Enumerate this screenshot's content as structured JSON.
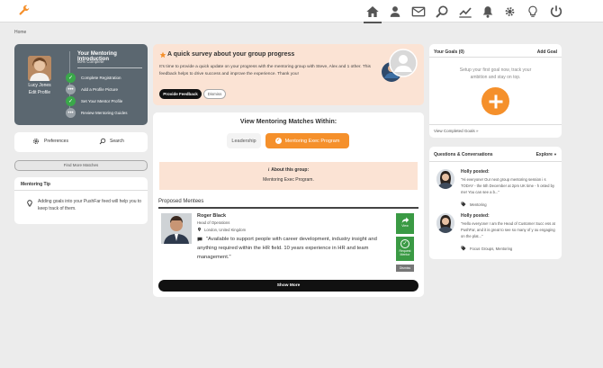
{
  "colors": {
    "accent": "#f5902b",
    "dark_panel": "#5b6770",
    "success": "#3aa84a",
    "survey_bg": "#fbe3d4"
  },
  "nav": {
    "icons": [
      "home-icon",
      "person-icon",
      "mail-icon",
      "search-icon",
      "chart-icon",
      "bell-icon",
      "gear-icon",
      "lightbulb-icon",
      "power-icon"
    ],
    "active": "home-icon"
  },
  "breadcrumb": "Home",
  "profile": {
    "name": "Lucy Jones",
    "edit_label": "Edit Profile",
    "intro_title": "Your Mentoring Introduction",
    "completion": "50% Complete",
    "steps": [
      {
        "label": "Complete Registration",
        "done": true
      },
      {
        "label": "Add a Profile Picture",
        "done": false
      },
      {
        "label": "Set Your Mentor Profile",
        "done": true
      },
      {
        "label": "Review Mentoring Guides",
        "done": false
      }
    ]
  },
  "actions": {
    "preferences": "Preferences",
    "search": "Search",
    "find_more": "Find More Matches"
  },
  "tip": {
    "title": "Mentoring Tip",
    "text": "Adding goals into your PushFar feed will help you to keep track of them."
  },
  "survey": {
    "title": "A quick survey about your group progress",
    "body": "It's time to provide a quick update on your progress with the mentoring group with Steve, Alex and 1 other. This feedback helps to drive success and improve the experience. Thank you!",
    "provide_label": "Provide Feedback",
    "dismiss_label": "Dismiss"
  },
  "matches": {
    "title": "View Mentoring Matches Within:",
    "tabs": [
      {
        "label": "Leadership",
        "active": false
      },
      {
        "label": "Mentoring Exec Program",
        "active": true
      }
    ],
    "about_title": "About this group:",
    "about_text": "Mentoring Exec Program.",
    "section_title": "Proposed Mentees",
    "mentee": {
      "name": "Roger Black",
      "role": "Head of Operations",
      "location": "London, United Kingdom",
      "quote": "\"Available to support people with career development, industry insight and anything required within the HR field. 10 years experience in HR and team management.\""
    },
    "view_label": "View",
    "request_label": "Request Mentor",
    "dismiss_label": "Dismiss",
    "show_more": "Show More"
  },
  "goals": {
    "title": "Your Goals (0)",
    "add_label": "Add Goal",
    "empty_text": "Setup your first goal now, track your ambition and stay on top.",
    "completed_link": "View Completed Goals »"
  },
  "qa": {
    "title": "Questions & Conversations",
    "explore": "Explore",
    "posts": [
      {
        "author": "Holly posted:",
        "text": "\"Hi everyone! Our next group mentoring session i s TODAY - the 5th December at 2pm UK time - h osted by me! You can see a b...\"",
        "tag": "Mentoring"
      },
      {
        "author": "Holly posted:",
        "text": "\"Hello everyone! I am the Head of Customer Succ ess at PushFar, and it is great to see so many of y ou engaging on the plat...\"",
        "tag": "Focus Groups, Mentoring"
      }
    ]
  }
}
